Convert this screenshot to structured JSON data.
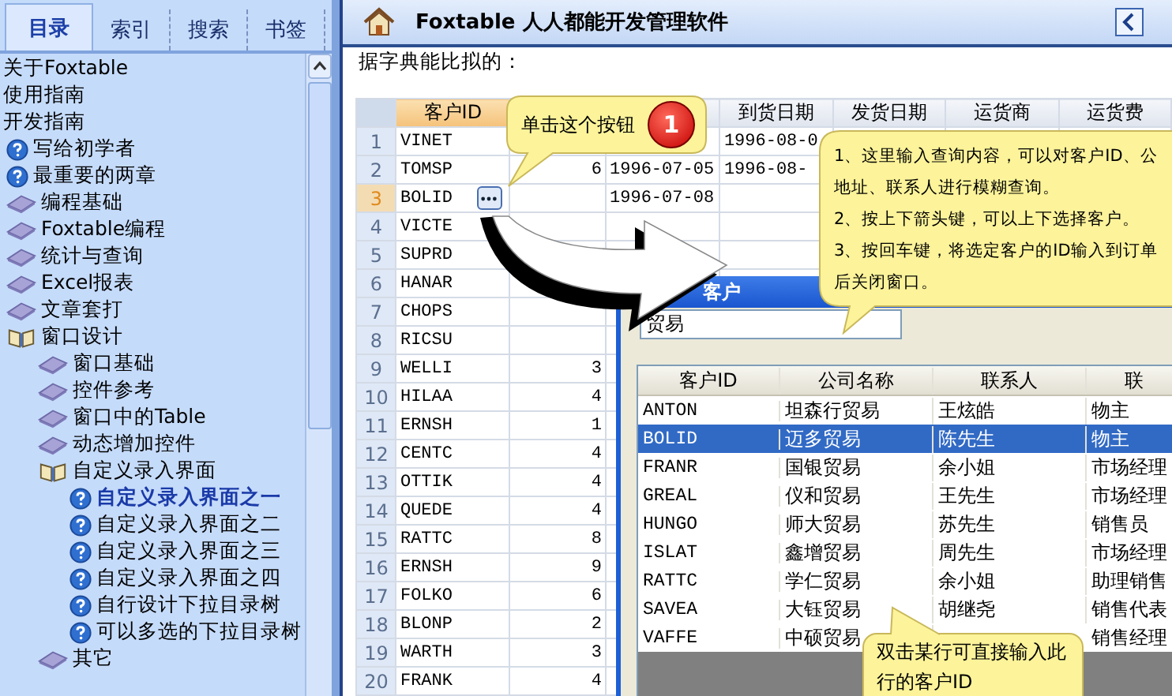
{
  "sidebar": {
    "tabs": [
      {
        "label": "目录",
        "selected": true
      },
      {
        "label": "索引",
        "selected": false
      },
      {
        "label": "搜索",
        "selected": false
      },
      {
        "label": "书签",
        "selected": false
      }
    ],
    "tree": [
      {
        "label": "关于Foxtable",
        "selected": false
      },
      {
        "label": "使用指南",
        "selected": false
      },
      {
        "label": "开发指南",
        "selected": false,
        "children": [
          {
            "label": "写给初学者",
            "kind": "help",
            "selected": false
          },
          {
            "label": "最重要的两章",
            "kind": "help",
            "selected": false
          },
          {
            "label": "编程基础",
            "kind": "book",
            "expanded": false,
            "selected": false
          },
          {
            "label": "Foxtable编程",
            "kind": "book",
            "expanded": false,
            "selected": false
          },
          {
            "label": "统计与查询",
            "kind": "book",
            "expanded": false,
            "selected": false
          },
          {
            "label": "Excel报表",
            "kind": "book",
            "expanded": false,
            "selected": false
          },
          {
            "label": "文章套打",
            "kind": "book",
            "expanded": false,
            "selected": false
          },
          {
            "label": "窗口设计",
            "kind": "book",
            "expanded": true,
            "selected": false,
            "children": [
              {
                "label": "窗口基础",
                "kind": "book",
                "expanded": false,
                "selected": false
              },
              {
                "label": "控件参考",
                "kind": "book",
                "expanded": false,
                "selected": false
              },
              {
                "label": "窗口中的Table",
                "kind": "book",
                "expanded": false,
                "selected": false
              },
              {
                "label": "动态增加控件",
                "kind": "book",
                "expanded": false,
                "selected": false
              },
              {
                "label": "自定义录入界面",
                "kind": "book",
                "expanded": true,
                "selected": false,
                "children": [
                  {
                    "label": "自定义录入界面之一",
                    "kind": "help",
                    "selected": true
                  },
                  {
                    "label": "自定义录入界面之二",
                    "kind": "help",
                    "selected": false
                  },
                  {
                    "label": "自定义录入界面之三",
                    "kind": "help",
                    "selected": false
                  },
                  {
                    "label": "自定义录入界面之四",
                    "kind": "help",
                    "selected": false
                  },
                  {
                    "label": "自行设计下拉目录树",
                    "kind": "help",
                    "selected": false
                  },
                  {
                    "label": "可以多选的下拉目录树",
                    "kind": "help",
                    "selected": false
                  }
                ]
              },
              {
                "label": "其它",
                "kind": "book",
                "expanded": false,
                "selected": false
              }
            ]
          }
        ]
      }
    ]
  },
  "header": {
    "title": "Foxtable 人人都能开发管理软件"
  },
  "intro_text": "据字典能比拟的：",
  "table": {
    "columns": [
      {
        "label": "客户ID",
        "selected": true
      },
      {
        "label": "到货日期",
        "selected": false
      },
      {
        "label": "发货日期",
        "selected": false
      },
      {
        "label": "运货商",
        "selected": false
      },
      {
        "label": "运货费",
        "selected": false
      }
    ],
    "rows": [
      {
        "num": "1",
        "customer_id": "VINET",
        "selected": false,
        "arrival": "1996-08-0"
      },
      {
        "num": "2",
        "customer_id": "TOMSP",
        "selected": false,
        "column_3": "6",
        "column_4": "1996-07-05",
        "arrival": "1996-08-"
      },
      {
        "num": "3",
        "customer_id": "BOLID",
        "selected": true,
        "column_4": "1996-07-08"
      },
      {
        "num": "4",
        "customer_id": "VICTE",
        "selected": false
      },
      {
        "num": "5",
        "customer_id": "SUPRD",
        "selected": false
      },
      {
        "num": "6",
        "customer_id": "HANAR",
        "selected": false
      },
      {
        "num": "7",
        "customer_id": "CHOPS",
        "selected": false
      },
      {
        "num": "8",
        "customer_id": "RICSU",
        "selected": false
      },
      {
        "num": "9",
        "customer_id": "WELLI",
        "selected": false,
        "column_3": "3"
      },
      {
        "num": "10",
        "customer_id": "HILAA",
        "selected": false,
        "column_3": "4"
      },
      {
        "num": "11",
        "customer_id": "ERNSH",
        "selected": false,
        "column_3": "1"
      },
      {
        "num": "12",
        "customer_id": "CENTC",
        "selected": false,
        "column_3": "4"
      },
      {
        "num": "13",
        "customer_id": "OTTIK",
        "selected": false,
        "column_3": "4"
      },
      {
        "num": "14",
        "customer_id": "QUEDE",
        "selected": false,
        "column_3": "4"
      },
      {
        "num": "15",
        "customer_id": "RATTC",
        "selected": false,
        "column_3": "8"
      },
      {
        "num": "16",
        "customer_id": "ERNSH",
        "selected": false,
        "column_3": "9"
      },
      {
        "num": "17",
        "customer_id": "FOLKO",
        "selected": false,
        "column_3": "6"
      },
      {
        "num": "18",
        "customer_id": "BLONP",
        "selected": false,
        "column_3": "2"
      },
      {
        "num": "19",
        "customer_id": "WARTH",
        "selected": false,
        "column_3": "3"
      },
      {
        "num": "20",
        "customer_id": "FRANK",
        "selected": false,
        "column_3": "4"
      }
    ]
  },
  "dialog": {
    "title": "客户",
    "search": {
      "value": "贸易"
    },
    "columns": [
      "客户ID",
      "公司名称",
      "联系人",
      "联"
    ],
    "rows": [
      {
        "cells": [
          "ANTON",
          "坦森行贸易",
          "王炫皓",
          "物主"
        ],
        "selected": false
      },
      {
        "cells": [
          "BOLID",
          "迈多贸易",
          "陈先生",
          "物主"
        ],
        "selected": true
      },
      {
        "cells": [
          "FRANR",
          "国银贸易",
          "余小姐",
          "市场经理"
        ],
        "selected": false
      },
      {
        "cells": [
          "GREAL",
          "仪和贸易",
          "王先生",
          "市场经理"
        ],
        "selected": false
      },
      {
        "cells": [
          "HUNGO",
          "师大贸易",
          "苏先生",
          "销售员"
        ],
        "selected": false
      },
      {
        "cells": [
          "ISLAT",
          "鑫增贸易",
          "周先生",
          "市场经理"
        ],
        "selected": false
      },
      {
        "cells": [
          "RATTC",
          "学仁贸易",
          "余小姐",
          "助理销售"
        ],
        "selected": false
      },
      {
        "cells": [
          "SAVEA",
          "大钰贸易",
          "胡继尧",
          "销售代表"
        ],
        "selected": false
      },
      {
        "cells": [
          "VAFFE",
          "中硕贸易",
          "",
          "销售经理"
        ],
        "selected": false
      }
    ]
  },
  "callouts": [
    {
      "text": "单击这个按钮",
      "badge": "1"
    },
    {
      "lines": [
        "1、这里输入查询内容，可以对客户ID、公",
        "地址、联系人进行模糊查询。",
        "2、按上下箭头键，可以上下选择客户。",
        "3、按回车键，将选定客户的ID输入到订单",
        "后关闭窗口。"
      ]
    },
    {
      "text": "双击某行可直接输入此行的客户ID"
    }
  ]
}
